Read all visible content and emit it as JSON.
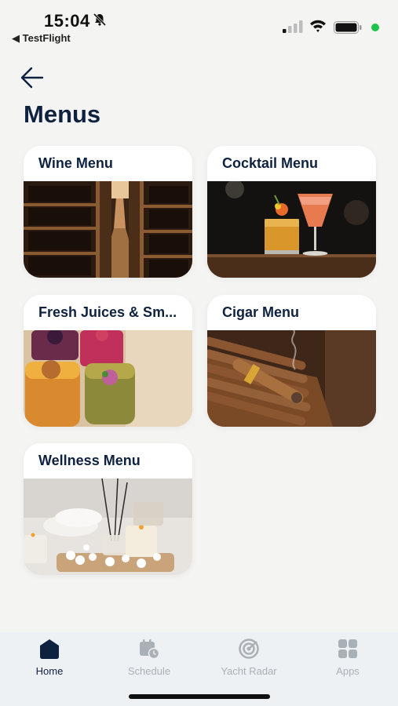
{
  "status_bar": {
    "time": "15:04",
    "back_app": "◀ TestFlight",
    "camera_indicator_color": "#1ec34a"
  },
  "header": {
    "back_icon": "arrow-left-icon",
    "title": "Menus"
  },
  "menu_cards": [
    {
      "title": "Wine Menu",
      "image": "wine-cellar-image"
    },
    {
      "title": "Cocktail Menu",
      "image": "cocktails-image"
    },
    {
      "title": "Fresh Juices & Sm...",
      "image": "juices-smoothies-image"
    },
    {
      "title": "Cigar Menu",
      "image": "cigars-image"
    },
    {
      "title": "Wellness Menu",
      "image": "spa-candles-image"
    }
  ],
  "tab_bar": {
    "tabs": [
      {
        "label": "Home",
        "icon": "home-icon",
        "active": true
      },
      {
        "label": "Schedule",
        "icon": "calendar-clock-icon",
        "active": false
      },
      {
        "label": "Yacht Radar",
        "icon": "radar-icon",
        "active": false
      },
      {
        "label": "Apps",
        "icon": "apps-grid-icon",
        "active": false
      }
    ],
    "active_color": "#0e2240",
    "inactive_color": "#a9b0b6"
  }
}
